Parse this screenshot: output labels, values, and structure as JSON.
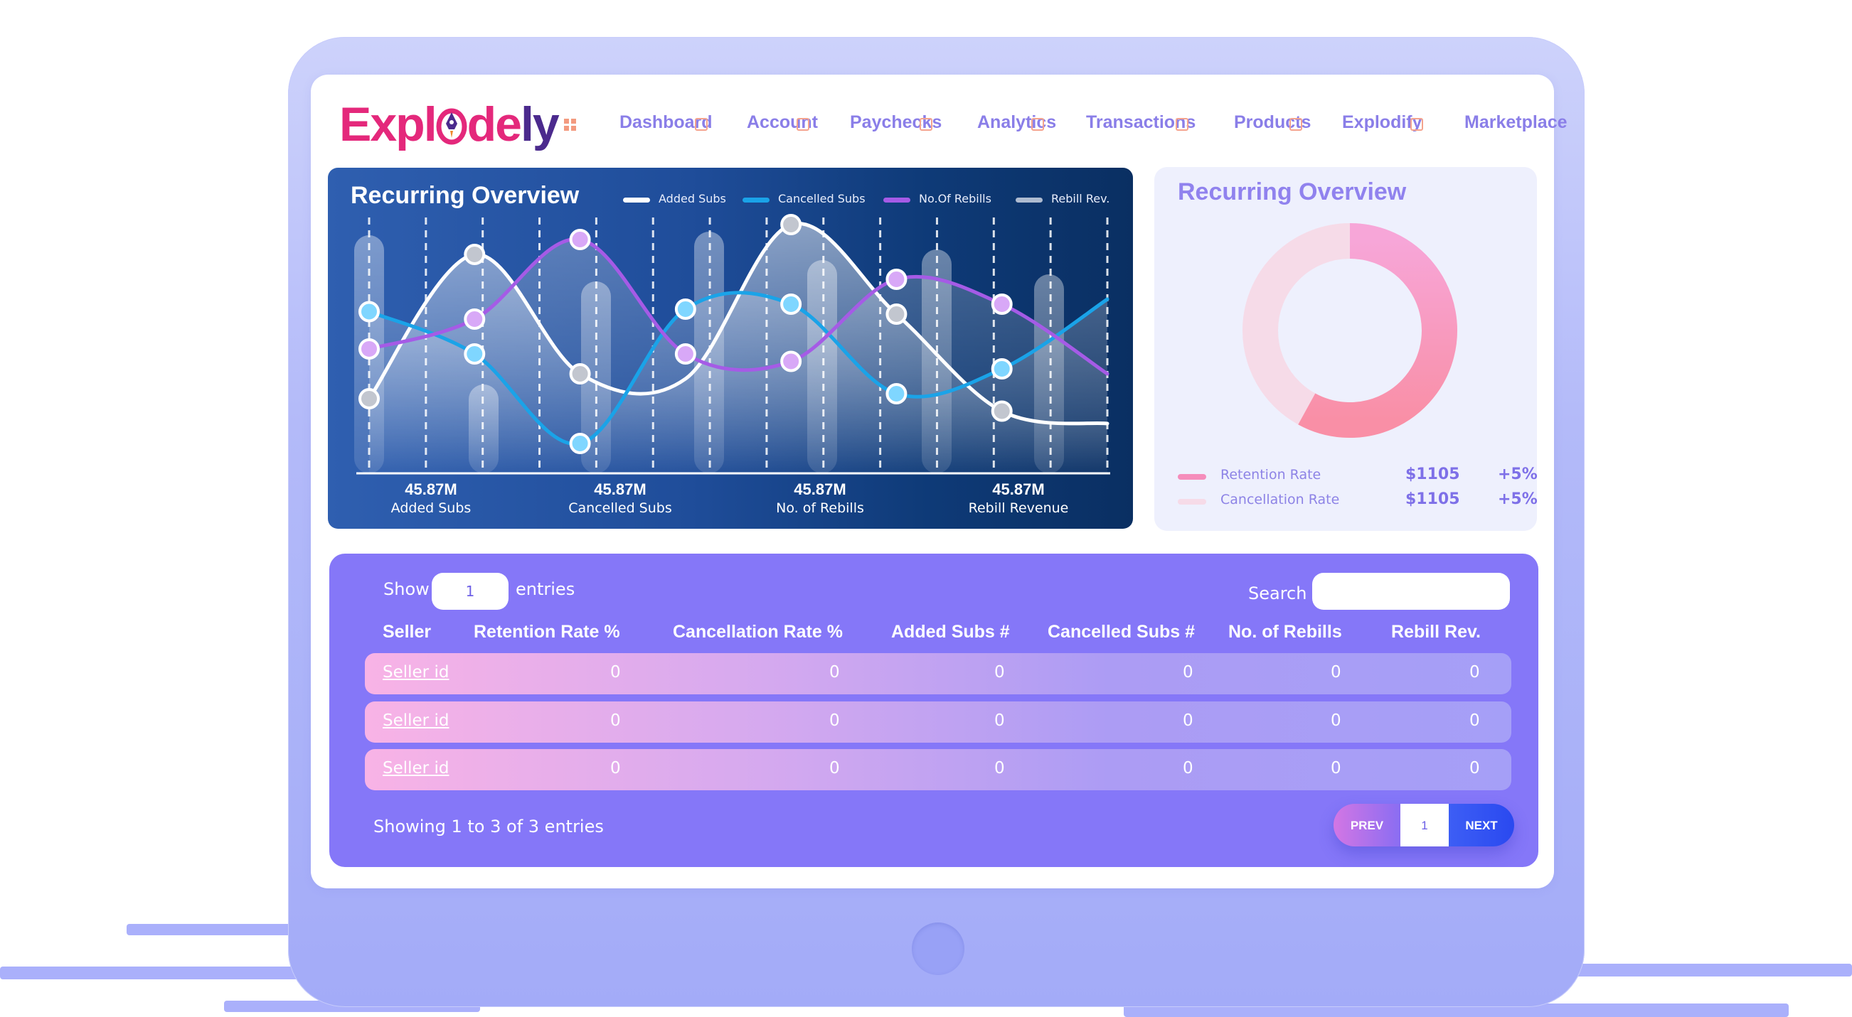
{
  "brand": {
    "logo_part1": "Expl",
    "logo_part2": "de",
    "logo_part3": "ly"
  },
  "nav": {
    "items": [
      "Dashboard",
      "Account",
      "Paychecks",
      "Analytics",
      "Transactions",
      "Products",
      "Explodify",
      "Marketplace"
    ]
  },
  "recurring_chart": {
    "title": "Recurring Overview",
    "legend": [
      "Added Subs",
      "Cancelled Subs",
      "No.Of Rebills",
      "Rebill Rev."
    ],
    "stats": [
      {
        "value": "45.87M",
        "label": "Added Subs"
      },
      {
        "value": "45.87M",
        "label": "Cancelled Subs"
      },
      {
        "value": "45.87M",
        "label": "No. of Rebills"
      },
      {
        "value": "45.87M",
        "label": "Rebill Revenue"
      }
    ],
    "colors": {
      "added": "#ffffff",
      "cancelled": "#1aa3e8",
      "rebills": "#a55be6",
      "rebill_rev": "#aebbd0"
    }
  },
  "chart_data": {
    "type": "line",
    "x": [
      0,
      1,
      2,
      3,
      4,
      5,
      6,
      7
    ],
    "series": [
      {
        "name": "Added Subs",
        "values": [
          30,
          88,
          40,
          38,
          100,
          64,
          25,
          20
        ]
      },
      {
        "name": "Cancelled Subs",
        "values": [
          65,
          48,
          12,
          66,
          68,
          32,
          42,
          70
        ]
      },
      {
        "name": "No.Of Rebills",
        "values": [
          50,
          62,
          94,
          48,
          45,
          78,
          68,
          40
        ]
      }
    ],
    "ylim": [
      0,
      100
    ]
  },
  "donut": {
    "title": "Recurring Overview",
    "retention_share": 0.58,
    "legend": [
      {
        "label": "Retention Rate",
        "amount": "$1105",
        "change": "+5%",
        "color": "#f58dbb"
      },
      {
        "label": "Cancellation Rate",
        "amount": "$1105",
        "change": "+5%",
        "color": "#f6dbe8"
      }
    ]
  },
  "table": {
    "show_label": "Show",
    "show_value": "1",
    "entries_label": "entries",
    "search_label": "Search",
    "search_value": "",
    "columns": [
      "Seller",
      "Retention Rate %",
      "Cancellation Rate %",
      "Added Subs #",
      "Cancelled Subs #",
      "No. of Rebills",
      "Rebill Rev."
    ],
    "rows": [
      [
        "Seller id",
        "0",
        "0",
        "0",
        "0",
        "0",
        "0"
      ],
      [
        "Seller id",
        "0",
        "0",
        "0",
        "0",
        "0",
        "0"
      ],
      [
        "Seller id",
        "0",
        "0",
        "0",
        "0",
        "0",
        "0"
      ]
    ],
    "showing_text": "Showing 1 to 3 of 3 entries",
    "pager": {
      "prev": "PREV",
      "page": "1",
      "next": "NEXT"
    }
  }
}
